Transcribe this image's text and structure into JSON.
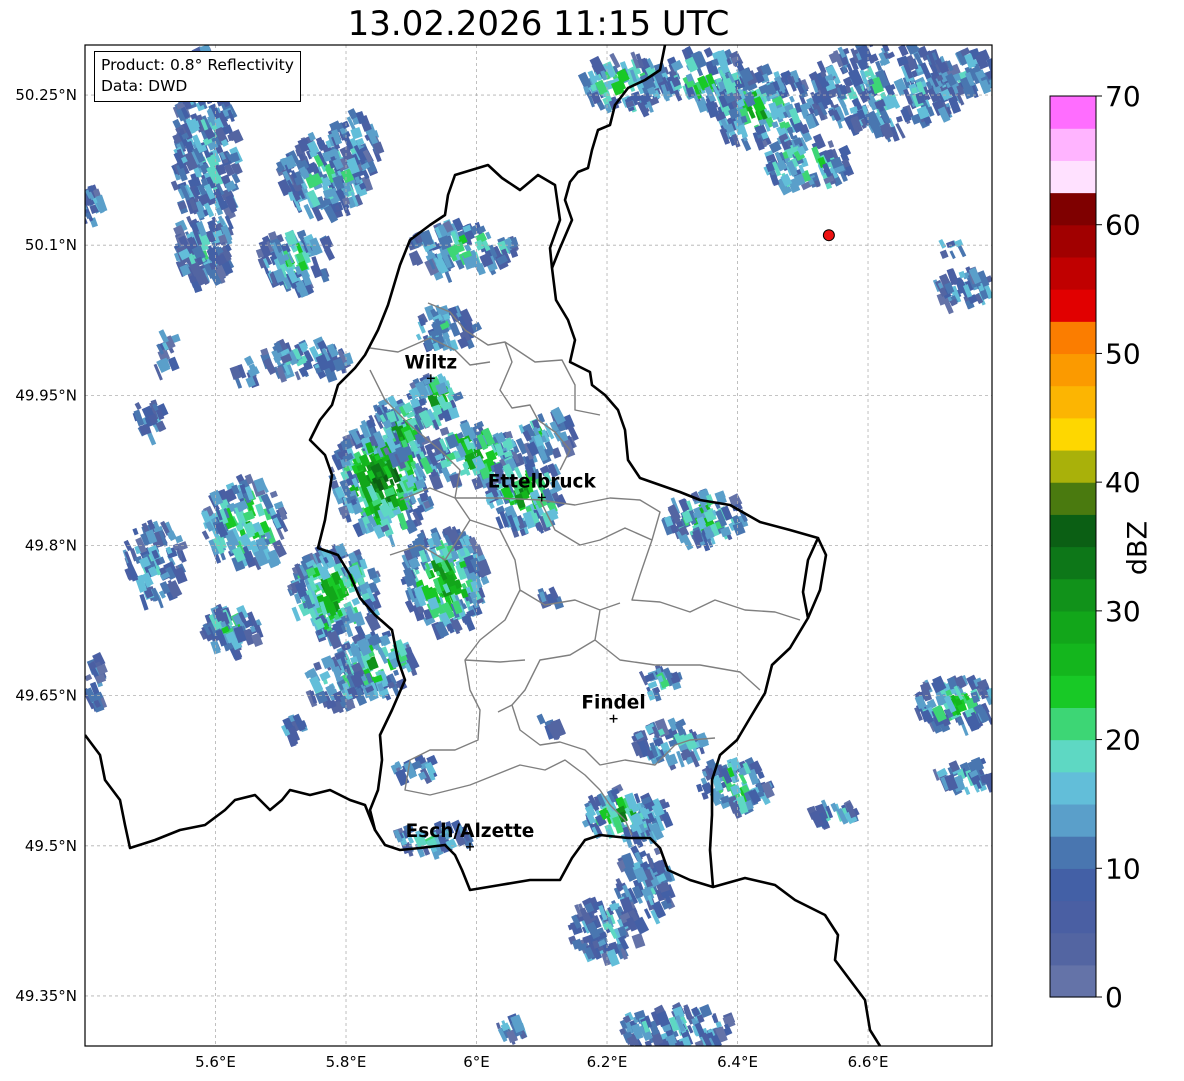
{
  "title": "13.02.2026 11:15 UTC",
  "info": {
    "product": "Product: 0.8° Reflectivity",
    "source": "Data: DWD"
  },
  "axes": {
    "lon_ticks": [
      "5.6°E",
      "5.8°E",
      "6°E",
      "6.2°E",
      "6.4°E",
      "6.6°E"
    ],
    "lat_ticks": [
      "50.25°N",
      "50.1°N",
      "49.95°N",
      "49.8°N",
      "49.65°N",
      "49.5°N",
      "49.35°N"
    ],
    "lon_values": [
      5.6,
      5.8,
      6.0,
      6.2,
      6.4,
      6.6
    ],
    "lat_values": [
      50.25,
      50.1,
      49.95,
      49.8,
      49.65,
      49.5,
      49.35
    ],
    "lon_range": [
      5.4,
      6.79
    ],
    "lat_range": [
      49.3,
      50.3
    ],
    "grid": "dashed"
  },
  "cities": [
    {
      "name": "Wiltz",
      "lon": 5.93,
      "lat": 49.967
    },
    {
      "name": "Ettelbruck",
      "lon": 6.1,
      "lat": 49.848
    },
    {
      "name": "Findel",
      "lon": 6.21,
      "lat": 49.627
    },
    {
      "name": "Esch/Alzette",
      "lon": 5.99,
      "lat": 49.499
    }
  ],
  "radar_site": {
    "lon": 6.54,
    "lat": 50.11,
    "color": "#ee1111"
  },
  "colorbar": {
    "label": "dBZ",
    "tick_labels": [
      "0",
      "10",
      "20",
      "30",
      "40",
      "50",
      "60",
      "70"
    ],
    "min": 0,
    "max": 70,
    "step": 2.5,
    "colors": [
      "#6473a8",
      "#5365a2",
      "#4a5fa3",
      "#4360a6",
      "#4976b0",
      "#5a9fca",
      "#62bed9",
      "#5ed8c3",
      "#3dd675",
      "#18c926",
      "#14b61d",
      "#12a61a",
      "#11921a",
      "#0d7718",
      "#0b5f14",
      "#4a7a0f",
      "#a9b10a",
      "#fed700",
      "#fcb502",
      "#fb9a00",
      "#fb7d00",
      "#e10000",
      "#c00000",
      "#a10000",
      "#7f0000",
      "#ffe1ff",
      "#ffb4ff",
      "#ff6dff",
      "#e935eb"
    ]
  }
}
